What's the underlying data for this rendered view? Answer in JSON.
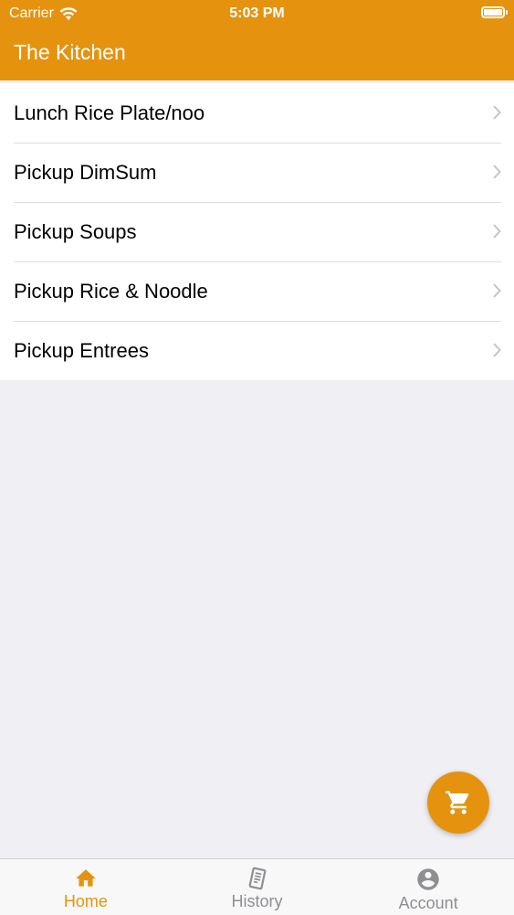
{
  "status": {
    "carrier": "Carrier",
    "time": "5:03 PM"
  },
  "header": {
    "title": "The Kitchen"
  },
  "menu": {
    "items": [
      {
        "label": "Lunch Rice Plate/noo"
      },
      {
        "label": "Pickup DimSum"
      },
      {
        "label": "Pickup Soups"
      },
      {
        "label": "Pickup Rice & Noodle"
      },
      {
        "label": "Pickup Entrees"
      }
    ]
  },
  "tabs": [
    {
      "label": "Home",
      "icon": "home-icon",
      "active": true
    },
    {
      "label": "History",
      "icon": "receipt-icon",
      "active": false
    },
    {
      "label": "Account",
      "icon": "account-icon",
      "active": false
    }
  ],
  "colors": {
    "accent": "#e5930f",
    "background": "#efeff4",
    "inactive": "#8e8e93"
  },
  "fab": {
    "icon": "cart-icon"
  }
}
